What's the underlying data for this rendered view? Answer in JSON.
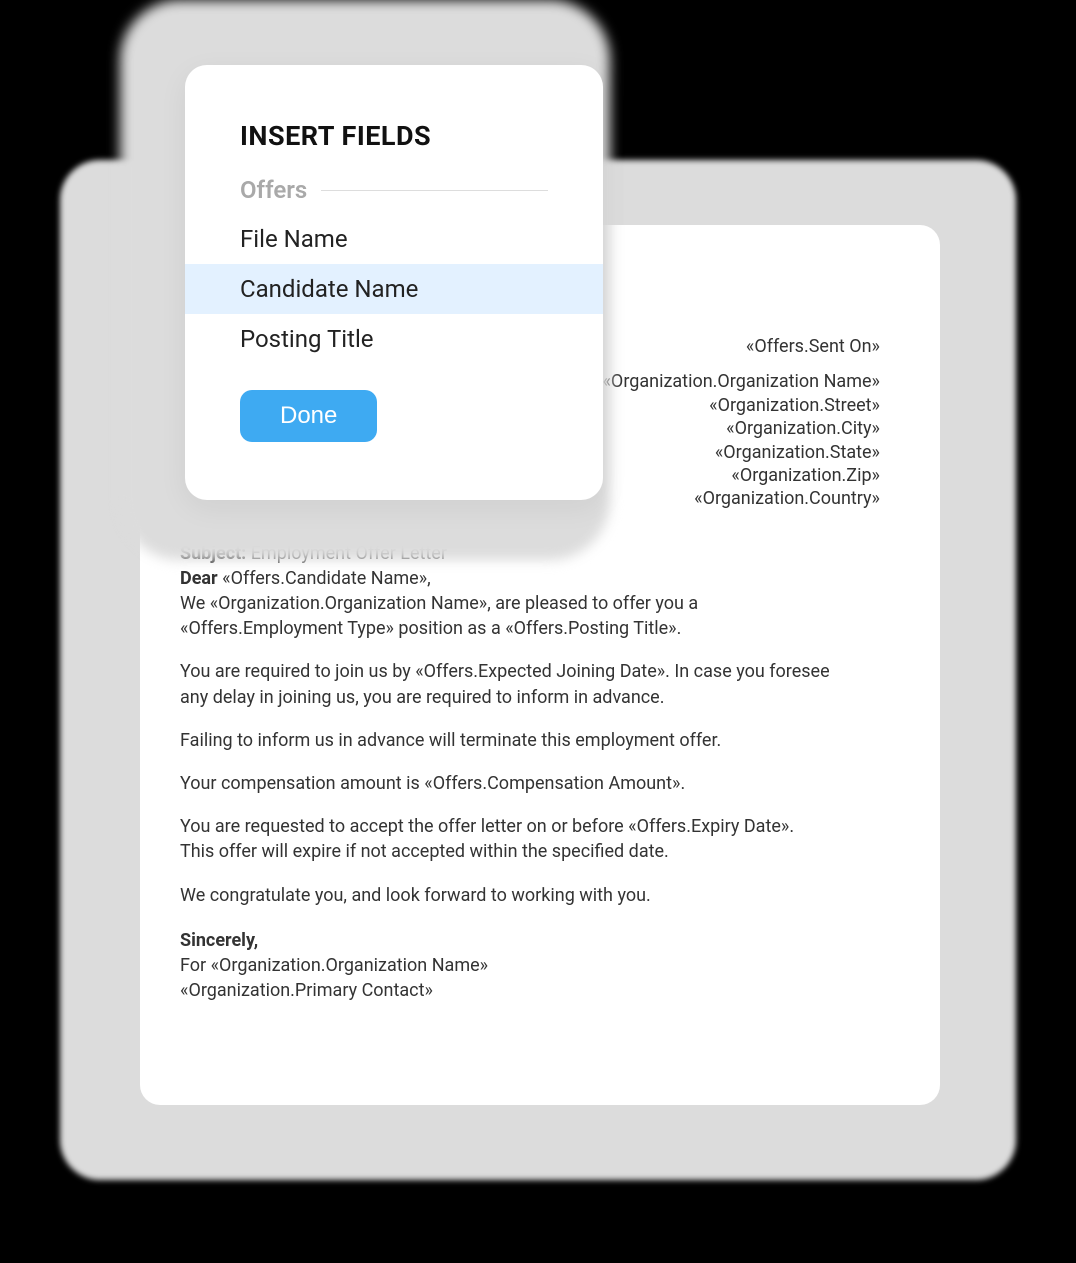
{
  "popover": {
    "title": "INSERT FIELDS",
    "section_label": "Offers",
    "items": [
      {
        "label": "File Name",
        "selected": false
      },
      {
        "label": "Candidate Name",
        "selected": true
      },
      {
        "label": "Posting Title",
        "selected": false
      }
    ],
    "done_label": "Done"
  },
  "letter": {
    "header_right": {
      "sent_on": "«Offers.Sent On»",
      "org_name": "«Organization.Organization Name»",
      "street": "«Organization.Street»",
      "city": "«Organization.City»",
      "state": "«Organization.State»",
      "zip": "«Organization.Zip»",
      "country": "«Organization.Country»"
    },
    "subject_label": "Subject:",
    "subject_value": "Employment Offer Letter",
    "dear_label": "Dear",
    "dear_value": "«Offers.Candidate Name»,",
    "p1_l1": "We «Organization.Organization Name», are pleased to offer you a",
    "p1_l2": "«Offers.Employment Type» position as a «Offers.Posting Title».",
    "p2_l1": "You are required to join us by «Offers.Expected Joining Date». In case you foresee",
    "p2_l2": "any delay in joining us, you are required to inform in advance.",
    "p3": "Failing to inform us in advance will terminate this employment offer.",
    "p4": "Your compensation amount is «Offers.Compensation Amount».",
    "p5_l1": "You are requested to accept the offer letter on or before «Offers.Expiry Date».",
    "p5_l2": "This offer will expire if not accepted within the specified date.",
    "p6": "We congratulate you, and look forward to working with you.",
    "sincerely": "Sincerely,",
    "for_org": "For «Organization.Organization Name»",
    "primary_contact": "«Organization.Primary Contact»"
  }
}
